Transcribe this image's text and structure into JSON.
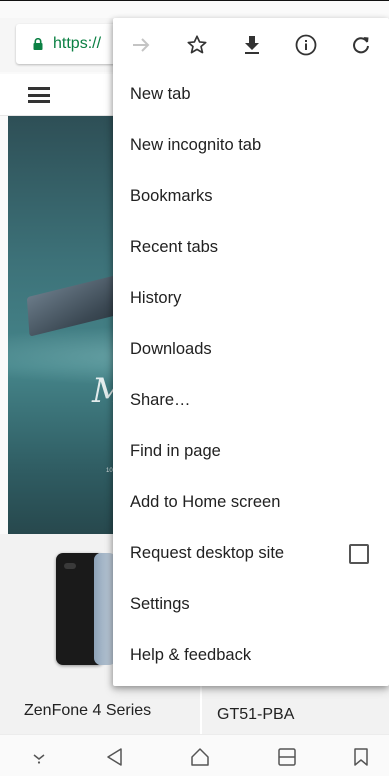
{
  "browser": {
    "url_text": "https://"
  },
  "menu": {
    "toolbar": [
      {
        "name": "forward-icon"
      },
      {
        "name": "bookmark-star-icon"
      },
      {
        "name": "download-icon"
      },
      {
        "name": "page-info-icon"
      },
      {
        "name": "reload-icon"
      }
    ],
    "items": [
      {
        "label": "New tab"
      },
      {
        "label": "New incognito tab"
      },
      {
        "label": "Bookmarks"
      },
      {
        "label": "Recent tabs"
      },
      {
        "label": "History"
      },
      {
        "label": "Downloads"
      },
      {
        "label": "Share…"
      },
      {
        "label": "Find in page"
      },
      {
        "label": "Add to Home screen"
      },
      {
        "label": "Request desktop site",
        "checkbox": false
      },
      {
        "label": "Settings"
      },
      {
        "label": "Help & feedback"
      }
    ]
  },
  "page": {
    "hero_text": "M",
    "hero_small": "10",
    "products": [
      {
        "title": "ZenFone 4 Series"
      },
      {
        "title": "GT51-PBA"
      }
    ]
  },
  "nav": {
    "buttons": [
      {
        "name": "nav-down-icon"
      },
      {
        "name": "back-icon"
      },
      {
        "name": "home-icon"
      },
      {
        "name": "recents-icon"
      },
      {
        "name": "bookmark-outline-icon"
      }
    ]
  },
  "colors": {
    "secure_green": "#0b8043",
    "menu_text": "#212121"
  }
}
